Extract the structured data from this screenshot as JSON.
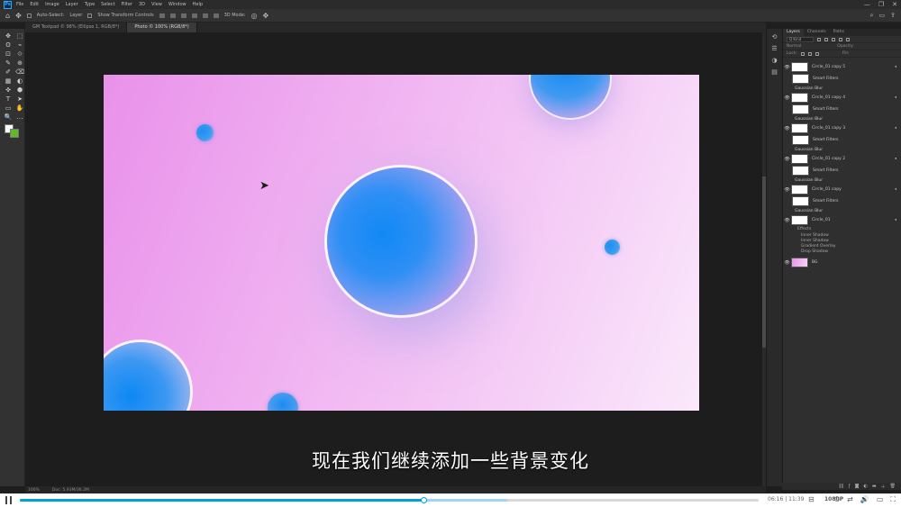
{
  "app": {
    "logo": "Ps"
  },
  "menu": [
    "File",
    "Edit",
    "Image",
    "Layer",
    "Type",
    "Select",
    "Filter",
    "3D",
    "View",
    "Window",
    "Help"
  ],
  "window_buttons": [
    "—",
    "❐",
    "✕"
  ],
  "options_bar": {
    "auto_select_label": "Auto-Select:",
    "layer_dropdown": "Layer",
    "show_transform_label": "Show Transform Controls",
    "mode_3d_label": "3D Mode:"
  },
  "doc_tabs": [
    {
      "label": "GM Textpad © 98% (Ellipse 1, RGB/8*)",
      "active": false
    },
    {
      "label": "Photo © 100% (RGB/8*)",
      "active": true
    }
  ],
  "toolbar": {
    "tools": [
      "✥",
      "⬚",
      "ʘ",
      "⌁",
      "⊡",
      "⟐",
      "✎",
      "⊕",
      "✐",
      "⌫",
      "▦",
      "◐",
      "✜",
      "⬢",
      "T",
      "➤",
      "▭",
      "✋",
      "🔍",
      "…"
    ]
  },
  "colors": {
    "foreground": "#ffffff",
    "background": "#5fb92d",
    "accent": "#00a1d6"
  },
  "status": {
    "zoom": "100%",
    "doc_info": "Doc: 5.93M/36.2M"
  },
  "subtitle": "现在我们继续添加一些背景变化",
  "layers_panel": {
    "tabs": [
      "Layers",
      "Channels",
      "Paths"
    ],
    "kind_filter": "Q Kind",
    "mode": "Normal",
    "opacity_label": "Opacity:",
    "fill_label": "Fill:",
    "lock_label": "Lock:",
    "layers": [
      {
        "name": "Circle_01 copy 5",
        "filter_mask": "Smart Filters",
        "filter": "Gaussian Blur"
      },
      {
        "name": "Circle_01 copy 4",
        "filter_mask": "Smart Filters",
        "filter": "Gaussian Blur"
      },
      {
        "name": "Circle_01 copy 3",
        "filter_mask": "Smart Filters",
        "filter": "Gaussian Blur"
      },
      {
        "name": "Circle_01 copy 2",
        "filter_mask": "Smart Filters",
        "filter": "Gaussian Blur"
      },
      {
        "name": "Circle_01 copy",
        "filter_mask": "Smart Filters",
        "filter": "Gaussian Blur"
      }
    ],
    "main_layer": {
      "name": "Circle_01",
      "effects_label": "Effects",
      "effects": [
        "Inner Shadow",
        "Inner Shadow",
        "Gradient Overlay",
        "Drop Shadow"
      ]
    },
    "bg_layer": "BG"
  },
  "player": {
    "time_current": "06:16",
    "time_total": "11:39",
    "quality": "1080P",
    "progress": 0.546,
    "buffered": 0.66
  }
}
